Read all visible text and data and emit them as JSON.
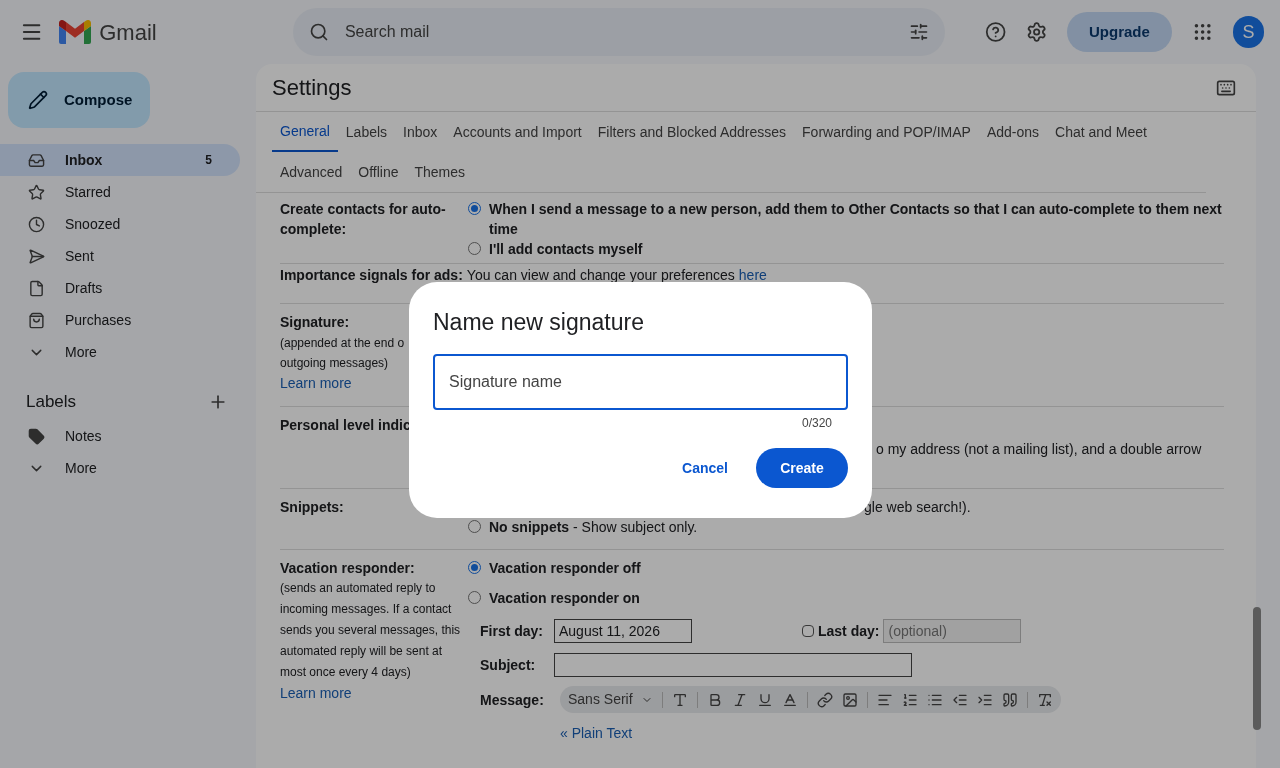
{
  "header": {
    "app_name": "Gmail",
    "search_placeholder": "Search mail",
    "upgrade": "Upgrade",
    "avatar_letter": "S"
  },
  "compose": "Compose",
  "sidebar": {
    "items": [
      {
        "label": "Inbox",
        "count": "5",
        "selected": true
      },
      {
        "label": "Starred",
        "selected": false
      },
      {
        "label": "Snoozed",
        "selected": false
      },
      {
        "label": "Sent",
        "selected": false
      },
      {
        "label": "Drafts",
        "selected": false
      },
      {
        "label": "Purchases",
        "selected": false
      },
      {
        "label": "More",
        "selected": false
      }
    ],
    "labels_title": "Labels",
    "labels": [
      {
        "label": "Notes",
        "kind": "label"
      },
      {
        "label": "More",
        "kind": "more"
      }
    ]
  },
  "settings": {
    "title": "Settings",
    "tabs": [
      {
        "label": "General",
        "selected": true
      },
      {
        "label": "Labels",
        "selected": false
      },
      {
        "label": "Inbox",
        "selected": false
      },
      {
        "label": "Accounts and Import",
        "selected": false
      },
      {
        "label": "Filters and Blocked Addresses",
        "selected": false
      },
      {
        "label": "Forwarding and POP/IMAP",
        "selected": false
      },
      {
        "label": "Add-ons",
        "selected": false
      },
      {
        "label": "Chat and Meet",
        "selected": false
      },
      {
        "label": "Advanced",
        "selected": false
      },
      {
        "label": "Offline",
        "selected": false
      },
      {
        "label": "Themes",
        "selected": false
      }
    ],
    "contacts": {
      "label": "Create contacts for auto-complete:",
      "options": [
        {
          "text": "When I send a message to a new person, add them to Other Contacts so that I can auto-complete to them next time",
          "selected": true
        },
        {
          "text": "I'll add contacts myself",
          "selected": false
        }
      ]
    },
    "importance": {
      "label": "Importance signals for ads:",
      "text": "You can view and change your preferences",
      "link": "here"
    },
    "signature": {
      "label": "Signature:",
      "note": [
        "(appended at the end o",
        "outgoing messages)"
      ],
      "link": "Learn more"
    },
    "personal": {
      "label": "Personal level indic",
      "fragment": "o my address (not a mailing list), and a double arrow"
    },
    "snippets": {
      "label": "Snippets:",
      "fragment": "gle web search!).",
      "option": {
        "text": "**No snippets** - Show subject only.",
        "selected": false
      }
    },
    "vacation": {
      "label": "Vacation responder:",
      "note": "(sends an automated reply to incoming messages. If a contact sends you several messages, this automated reply will be sent at most once every 4 days)",
      "link": "Learn more",
      "options": [
        {
          "text": "Vacation responder off",
          "selected": true
        },
        {
          "text": "Vacation responder on",
          "selected": false
        }
      ],
      "first_day_label": "First day:",
      "first_day": "August 11, 2026",
      "last_day_label": "Last day:",
      "last_day_checked": false,
      "last_day_placeholder": "(optional)",
      "subject_label": "Subject:",
      "message_label": "Message:",
      "font": "Sans Serif",
      "plain_text_link": "« Plain Text"
    }
  },
  "dialog": {
    "title": "Name new signature",
    "placeholder": "Signature name",
    "counter": "0/320",
    "cancel": "Cancel",
    "create": "Create"
  }
}
